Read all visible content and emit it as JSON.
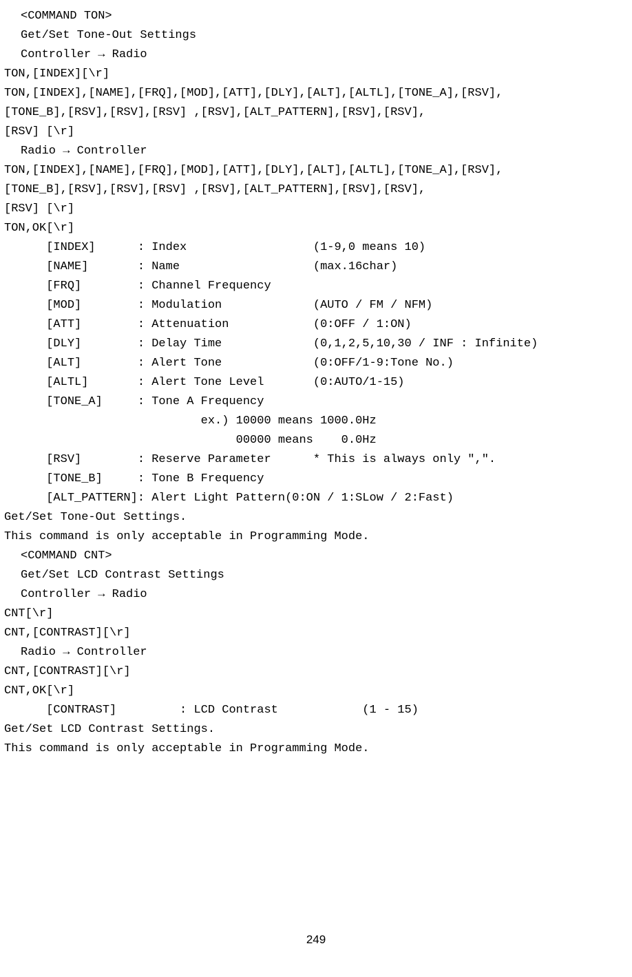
{
  "page_number": "249",
  "lines": [
    {
      "cls": "indent1",
      "t": "<COMMAND TON>"
    },
    {
      "cls": "indent1",
      "t": "Get/Set Tone-Out Settings"
    },
    {
      "cls": "indent1",
      "t": "Controller → Radio"
    },
    {
      "cls": "",
      "t": "TON,[INDEX][\\r]"
    },
    {
      "cls": "",
      "t": "TON,[INDEX],[NAME],[FRQ],[MOD],[ATT],[DLY],[ALT],[ALTL],[TONE_A],[RSV],"
    },
    {
      "cls": "",
      "t": "[TONE_B],[RSV],[RSV],[RSV] ,[RSV],[ALT_PATTERN],[RSV],[RSV],"
    },
    {
      "cls": "",
      "t": "[RSV] [\\r]"
    },
    {
      "cls": "indent1",
      "t": "Radio → Controller"
    },
    {
      "cls": "",
      "t": "TON,[INDEX],[NAME],[FRQ],[MOD],[ATT],[DLY],[ALT],[ALTL],[TONE_A],[RSV],"
    },
    {
      "cls": "",
      "t": "[TONE_B],[RSV],[RSV],[RSV] ,[RSV],[ALT_PATTERN],[RSV],[RSV],"
    },
    {
      "cls": "",
      "t": "[RSV] [\\r]"
    },
    {
      "cls": "",
      "t": "TON,OK[\\r]"
    },
    {
      "cls": "",
      "t": ""
    },
    {
      "cls": "",
      "t": "      [INDEX]      : Index                  (1-9,0 means 10)"
    },
    {
      "cls": "",
      "t": "      [NAME]       : Name                   (max.16char)"
    },
    {
      "cls": "",
      "t": "      [FRQ]        : Channel Frequency"
    },
    {
      "cls": "",
      "t": "      [MOD]        : Modulation             (AUTO / FM / NFM)"
    },
    {
      "cls": "",
      "t": "      [ATT]        : Attenuation            (0:OFF / 1:ON)"
    },
    {
      "cls": "",
      "t": "      [DLY]        : Delay Time             (0,1,2,5,10,30 / INF : Infinite)"
    },
    {
      "cls": "",
      "t": "      [ALT]        : Alert Tone             (0:OFF/1-9:Tone No.)"
    },
    {
      "cls": "",
      "t": "      [ALTL]       : Alert Tone Level       (0:AUTO/1-15)"
    },
    {
      "cls": "",
      "t": "      [TONE_A]     : Tone A Frequency"
    },
    {
      "cls": "",
      "t": "                            ex.) 10000 means 1000.0Hz"
    },
    {
      "cls": "",
      "t": "                                 00000 means    0.0Hz"
    },
    {
      "cls": "",
      "t": "      [RSV]        : Reserve Parameter      * This is always only \",\"."
    },
    {
      "cls": "",
      "t": "      [TONE_B]     : Tone B Frequency"
    },
    {
      "cls": "",
      "t": "      [ALT_PATTERN]: Alert Light Pattern(0:ON / 1:SLow / 2:Fast)"
    },
    {
      "cls": "",
      "t": ""
    },
    {
      "cls": "",
      "t": "Get/Set Tone-Out Settings."
    },
    {
      "cls": "",
      "t": "This command is only acceptable in Programming Mode."
    },
    {
      "cls": "",
      "t": ""
    },
    {
      "cls": "indent1",
      "t": "<COMMAND CNT>"
    },
    {
      "cls": "indent1",
      "t": "Get/Set LCD Contrast Settings"
    },
    {
      "cls": "indent1",
      "t": "Controller → Radio"
    },
    {
      "cls": "",
      "t": "CNT[\\r]"
    },
    {
      "cls": "",
      "t": "CNT,[CONTRAST][\\r]"
    },
    {
      "cls": "indent1",
      "t": "Radio → Controller"
    },
    {
      "cls": "",
      "t": "CNT,[CONTRAST][\\r]"
    },
    {
      "cls": "",
      "t": "CNT,OK[\\r]"
    },
    {
      "cls": "",
      "t": ""
    },
    {
      "cls": "",
      "t": "      [CONTRAST]         : LCD Contrast            (1 - 15)"
    },
    {
      "cls": "",
      "t": ""
    },
    {
      "cls": "",
      "t": "Get/Set LCD Contrast Settings."
    },
    {
      "cls": "",
      "t": "This command is only acceptable in Programming Mode."
    }
  ]
}
